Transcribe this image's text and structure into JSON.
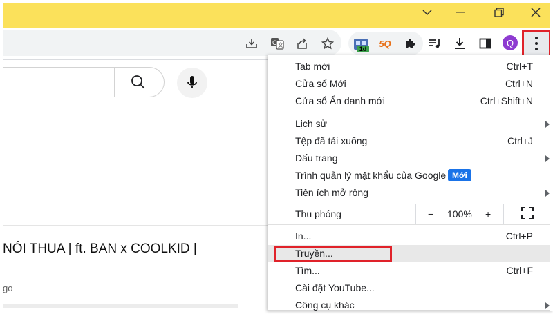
{
  "window": {
    "controls": [
      "chevron-down",
      "minimize",
      "restore",
      "close"
    ]
  },
  "toolbar": {
    "omnibox_icons": [
      "install-app-icon",
      "translate-icon",
      "share-icon",
      "bookmark-star-icon"
    ],
    "extensions_badge": "1d",
    "ext2_label": "5Q",
    "avatar_letter": "Q"
  },
  "page": {
    "video_title": "NÓI THUA | ft. BAN x COOLKID |",
    "channel_text": "go"
  },
  "menu": {
    "items": [
      {
        "label": "Tab mới",
        "shortcut": "Ctrl+T"
      },
      {
        "label": "Cửa sổ Mới",
        "shortcut": "Ctrl+N"
      },
      {
        "label": "Cửa sổ Ẩn danh mới",
        "shortcut": "Ctrl+Shift+N"
      },
      {
        "label": "Lịch sử"
      },
      {
        "label": "Tệp đã tải xuống",
        "shortcut": "Ctrl+J"
      },
      {
        "label": "Dấu trang"
      },
      {
        "label": "Trình quản lý mật khẩu của Google",
        "badge": "Mới"
      },
      {
        "label": "Tiện ích mở rộng"
      },
      {
        "label": "Thu phóng"
      },
      {
        "label": "In...",
        "shortcut": "Ctrl+P"
      },
      {
        "label": "Truyền..."
      },
      {
        "label": "Tìm...",
        "shortcut": "Ctrl+F"
      },
      {
        "label": "Cài đặt YouTube..."
      },
      {
        "label": "Công cụ khác"
      }
    ],
    "zoom": {
      "minus": "−",
      "value": "100%",
      "plus": "+"
    }
  },
  "colors": {
    "titlebar": "#fbe15b",
    "highlight_border": "#e0222a",
    "badge_blue": "#1a73e8"
  }
}
